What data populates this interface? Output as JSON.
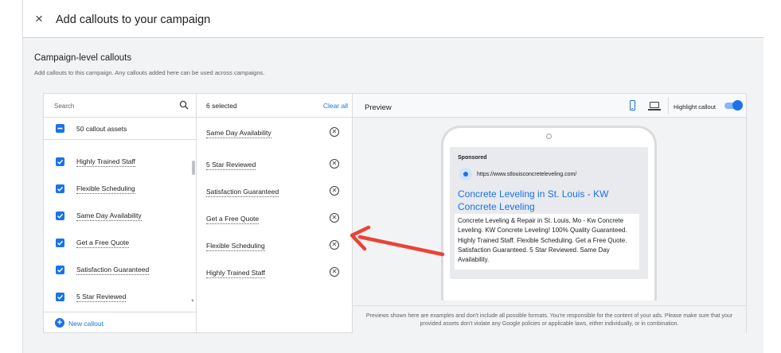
{
  "dialog": {
    "close_glyph": "×",
    "title": "Add callouts to your campaign"
  },
  "section": {
    "title": "Campaign-level callouts",
    "description": "Add callouts to this campaign. Any callouts added here can be used across campaigns."
  },
  "assets_list": {
    "search_placeholder": "Search",
    "header_label": "50 callout assets",
    "items": [
      {
        "label": "Highly Trained Staff",
        "checked": true
      },
      {
        "label": "Flexible Scheduling",
        "checked": true
      },
      {
        "label": "Same Day Availability",
        "checked": true
      },
      {
        "label": "Get a Free Quote",
        "checked": true
      },
      {
        "label": "Satisfaction Guaranteed",
        "checked": true
      },
      {
        "label": "5 Star Reviewed",
        "checked": true
      }
    ],
    "new_callout_label": "New callout"
  },
  "selected_list": {
    "count_label": "6 selected",
    "clear_all_label": "Clear all",
    "items": [
      "Same Day Availability",
      "5 Star Reviewed",
      "Satisfaction Guaranteed",
      "Get a Free Quote",
      "Flexible Scheduling",
      "Highly Trained Staff"
    ]
  },
  "preview": {
    "title": "Preview",
    "highlight_label": "Highlight callout",
    "highlight_on": true,
    "device_selected": "mobile",
    "ad": {
      "sponsored": "Sponsored",
      "url": "https://www.stlouisconcreteleveling.com/",
      "headline": "Concrete Leveling in St. Louis - KW Concrete Leveling",
      "description": "Concrete Leveling & Repair in St. Louis, Mo - Kw Concrete Leveling. KW Concrete Leveling! 100% Quality Guaranteed. Highly Trained Staff. Flexible Scheduling. Get a Free Quote. Satisfaction Guaranteed. 5 Star Reviewed. Same Day Availability."
    },
    "footer_note": "Previews shown here are examples and don't include all possible formats. You're responsible for the content of your ads. Please make sure that your provided assets don't violate any Google policies or applicable laws, either individually, or in combination."
  },
  "colors": {
    "accent": "#1a73e8",
    "annotation_arrow": "#ea4335"
  }
}
